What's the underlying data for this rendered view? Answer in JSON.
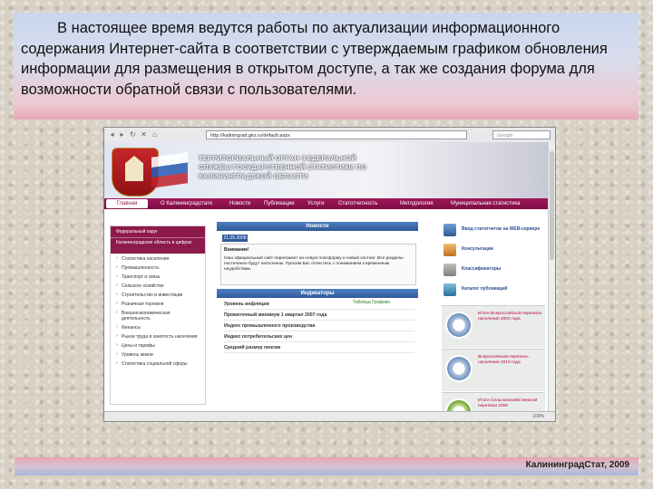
{
  "slide": {
    "paragraph": "В настоящее время ведутся работы по актуализации информационного содержания Интернет-сайта в соответствии с утверждаемым графиком обновления информации для размещения в открытом доступе, а так же создания форума для возможности обратной связи с пользователями.",
    "footer": "КалининградСтат, 2009"
  },
  "browser": {
    "url": "http://kaliningrad.gks.ru/default.aspx",
    "search_placeholder": "Google",
    "status_text": "",
    "zoom": "100%"
  },
  "site": {
    "title_line1": "ТЕРРИТОРИАЛЬНЫЙ ОРГАН ФЕДЕРАЛЬНОЙ",
    "title_line2": "СЛУЖБЫ ГОСУДАРСТВЕННОЙ СТАТИСТИКИ ПО",
    "title_line3": "КАЛИНИНГРАДСКОЙ ОБЛАСТИ",
    "menu": [
      "Главная",
      "О Калининградстате",
      "Новости",
      "Публикации",
      "Услуги",
      "Статотчетность",
      "Методология",
      "Муниципальная статистика"
    ],
    "sidebar_header": "Федеральный округ",
    "sidebar_selected": "Калининградская область в цифрах",
    "sidebar_items": [
      "Статистика населения",
      "Промышленность",
      "Транспорт и связь",
      "Сельское хозяйство",
      "Строительство и инвестиции",
      "Розничная торговля",
      "Внешнеэкономическая деятельность",
      "Финансы",
      "Рынок труда и занятость населения",
      "Цены и тарифы",
      "Уровень жизни",
      "Статистика социальной сферы"
    ],
    "news_header": "Новости",
    "news_date": "21.05.2009",
    "news_title": "Внимание!",
    "news_text": "Наш официальный сайт переезжает на новую платформу и новый хостинг. Все разделы постепенно будут наполнены. Просим Вас отнестись с пониманием к временным неудобствам.",
    "indicators_header": "Индикаторы",
    "indicators_legend": "Таблица   Графики",
    "indicators": [
      "Уровень инфляции",
      "Прожиточный минимум 1 квартал 2007 года",
      "Индекс промышленного производства",
      "Индекс потребительских цен",
      "Средний размер пенсии"
    ],
    "right_links": [
      "Ввод статотчетов на WEB-сервере",
      "Консультации",
      "Классификаторы",
      "Каталог публикаций"
    ],
    "census": [
      "Итоги Всероссийской переписи населения 2002 года",
      "Всероссийская перепись населения 2010 года",
      "Итоги Сельскохозяйственной переписи 2006"
    ]
  }
}
